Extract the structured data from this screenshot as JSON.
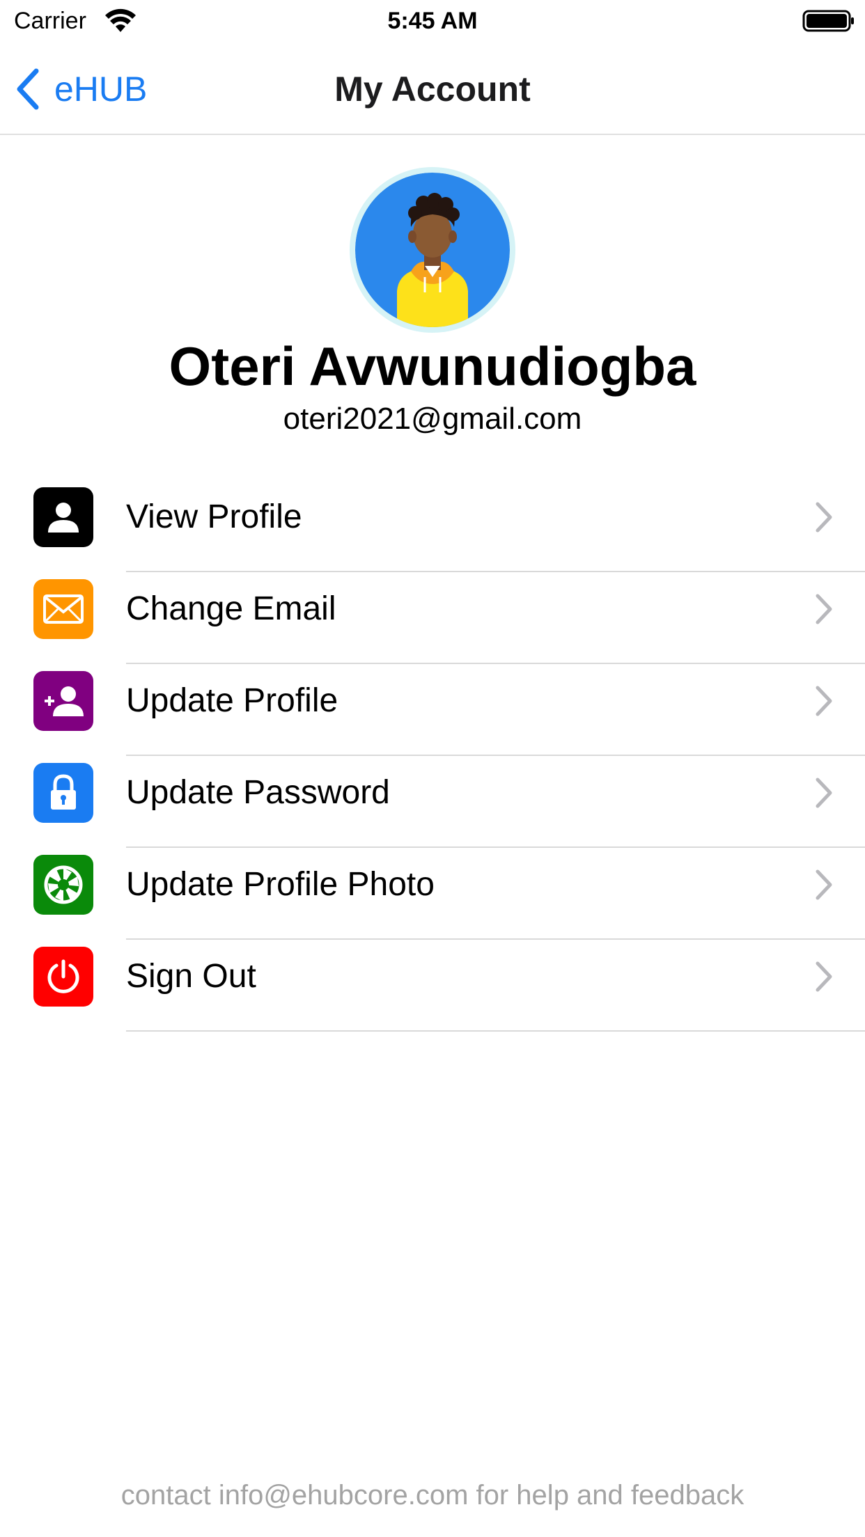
{
  "status_bar": {
    "carrier": "Carrier",
    "time": "5:45 AM",
    "wifi_icon": "wifi-icon",
    "battery_icon": "battery-icon"
  },
  "nav": {
    "back_label": "eHUB",
    "title": "My Account",
    "back_icon": "chevron-left-icon",
    "accent_color": "#1a7cf2"
  },
  "profile": {
    "name": "Oteri Avwunudiogba",
    "email": "oteri2021@gmail.com",
    "avatar_icon": "avatar-icon"
  },
  "menu": {
    "items": [
      {
        "label": "View Profile",
        "icon": "person-icon",
        "color": "#000000"
      },
      {
        "label": "Change Email",
        "icon": "envelope-icon",
        "color": "#ff9500"
      },
      {
        "label": "Update Profile",
        "icon": "person-add-icon",
        "color": "#800080"
      },
      {
        "label": "Update Password",
        "icon": "lock-icon",
        "color": "#1a7cf2"
      },
      {
        "label": "Update Profile Photo",
        "icon": "camera-aperture-icon",
        "color": "#0a8a0a"
      },
      {
        "label": "Sign Out",
        "icon": "power-icon",
        "color": "#ff0000"
      }
    ]
  },
  "footer": {
    "text": "contact info@ehubcore.com for help and feedback"
  }
}
